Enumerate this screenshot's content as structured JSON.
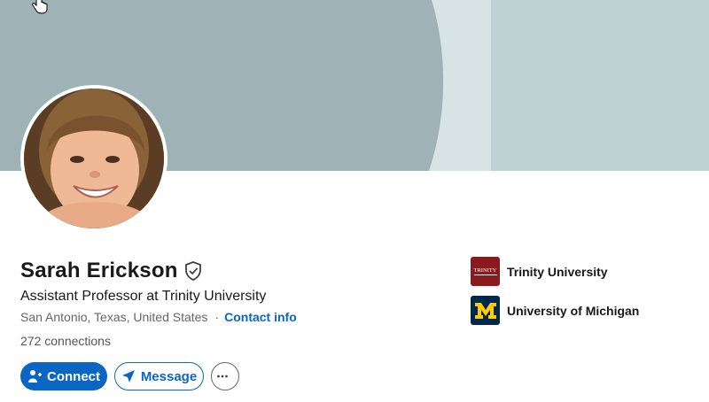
{
  "colors": {
    "primary": "#0a66c2",
    "banner_dark": "#9fb2b5",
    "banner_light": "#bfd2d4",
    "banner_strip": "#d7e3e4",
    "michigan_blue": "#00274c",
    "michigan_maize": "#ffcb05",
    "trinity_maroon": "#8a1a1e"
  },
  "profile": {
    "name": "Sarah Erickson",
    "verified_icon": "shield-check-icon",
    "headline": "Assistant Professor at Trinity University",
    "location": "San Antonio, Texas, United States",
    "separator": "·",
    "contact_link": "Contact info",
    "connections": "272 connections"
  },
  "actions": {
    "connect_label": "Connect",
    "message_label": "Message",
    "more_icon": "ellipsis-icon"
  },
  "education": [
    {
      "name": "Trinity University",
      "logo_text": "TRINITY"
    },
    {
      "name": "University of Michigan",
      "logo_text": "M"
    }
  ]
}
